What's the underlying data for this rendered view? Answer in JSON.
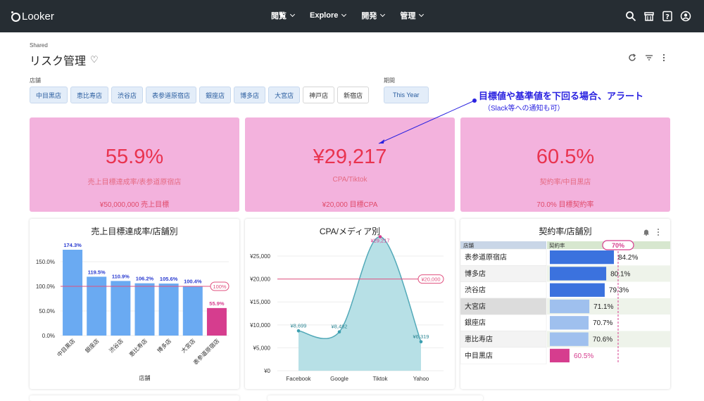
{
  "app": {
    "logo": "Looker"
  },
  "nav": [
    {
      "label": "閲覧"
    },
    {
      "label": "Explore"
    },
    {
      "label": "開発"
    },
    {
      "label": "管理"
    }
  ],
  "header": {
    "breadcrumb": "Shared",
    "title": "リスク管理"
  },
  "filters": {
    "store_label": "店舗",
    "stores": [
      {
        "label": "中目黒店",
        "selected": true
      },
      {
        "label": "恵比寿店",
        "selected": true
      },
      {
        "label": "渋谷店",
        "selected": true
      },
      {
        "label": "表参道原宿店",
        "selected": true
      },
      {
        "label": "銀座店",
        "selected": true
      },
      {
        "label": "博多店",
        "selected": true
      },
      {
        "label": "大宮店",
        "selected": true
      },
      {
        "label": "神戸店",
        "selected": false
      },
      {
        "label": "新宿店",
        "selected": false
      }
    ],
    "period_label": "期間",
    "period_value": "This Year"
  },
  "annotation": {
    "main": "目標値や基準値を下回る場合、アラート",
    "sub": "（Slack等への通知も可）",
    "color": "#2a22e0"
  },
  "kpis": [
    {
      "value": "55.9%",
      "label": "売上目標達成率/表参道原宿店",
      "target": "¥50,000,000 売上目標"
    },
    {
      "value": "¥29,217",
      "label": "CPA/Tiktok",
      "target": "¥20,000 目標CPA"
    },
    {
      "value": "60.5%",
      "label": "契約率/中目黒店",
      "target": "70.0% 目標契約率"
    }
  ],
  "colors": {
    "kpi_bg": "#f3b2dd",
    "kpi_text": "#e9334f",
    "bar_blue": "#6aaaf2",
    "bar_alert": "#d63d8e",
    "area_fill": "#b7e0e6",
    "ref_line": "#e0507f"
  },
  "chart_data": [
    {
      "type": "bar",
      "title": "売上目標達成率/店舗別",
      "xlabel": "店舗",
      "ylabel": "",
      "categories": [
        "中目黒店",
        "銀座店",
        "渋谷店",
        "恵比寿店",
        "博多店",
        "大宮店",
        "表参道原宿店"
      ],
      "values": [
        174.3,
        119.5,
        110.9,
        106.2,
        105.6,
        100.4,
        55.9
      ],
      "value_labels": [
        "174.3%",
        "119.5%",
        "110.9%",
        "106.2%",
        "105.6%",
        "100.4%",
        "55.9%"
      ],
      "yticks": [
        "0.0%",
        "50.0%",
        "100.0%",
        "150.0%"
      ],
      "ylim": [
        0,
        180
      ],
      "reference": {
        "value": 100,
        "label": "100%"
      }
    },
    {
      "type": "area",
      "title": "CPA/メディア別",
      "categories": [
        "Facebook",
        "Google",
        "Tiktok",
        "Yahoo"
      ],
      "values": [
        8699,
        8482,
        29217,
        6319
      ],
      "value_labels": [
        "¥8,699",
        "¥8,482",
        "¥29,217",
        "¥6,319"
      ],
      "yticks": [
        "¥0",
        "¥5,000",
        "¥10,000",
        "¥15,000",
        "¥20,000",
        "¥25,000"
      ],
      "ylim": [
        0,
        27000
      ],
      "reference": {
        "value": 20000,
        "label": "¥20,000"
      }
    },
    {
      "type": "table",
      "title": "契約率/店舗別",
      "columns": [
        "店舗",
        "契約率"
      ],
      "rows": [
        {
          "store": "表参道原宿店",
          "rate": 84.2,
          "label": "84.2%"
        },
        {
          "store": "博多店",
          "rate": 80.1,
          "label": "80.1%"
        },
        {
          "store": "渋谷店",
          "rate": 79.3,
          "label": "79.3%"
        },
        {
          "store": "大宮店",
          "rate": 71.1,
          "label": "71.1%"
        },
        {
          "store": "銀座店",
          "rate": 70.7,
          "label": "70.7%"
        },
        {
          "store": "恵比寿店",
          "rate": 70.6,
          "label": "70.6%"
        },
        {
          "store": "中目黒店",
          "rate": 60.5,
          "label": "60.5%"
        }
      ],
      "reference": {
        "value": 70,
        "label": "70%"
      },
      "scale_max": 100
    }
  ]
}
